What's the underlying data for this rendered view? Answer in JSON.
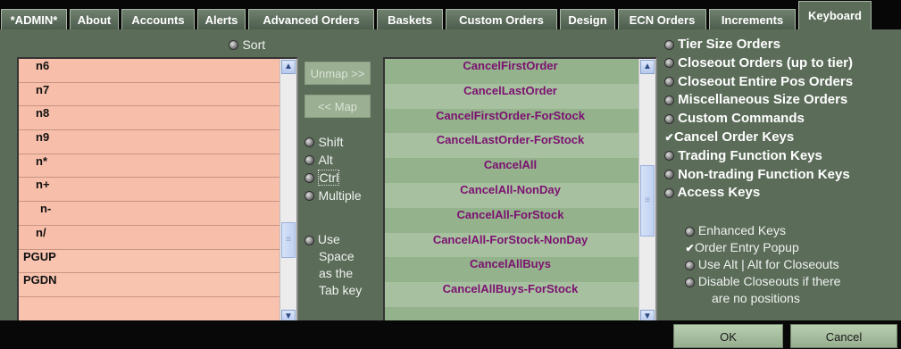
{
  "tabs": [
    "*ADMIN*",
    "About",
    "Accounts",
    "Alerts",
    "Advanced Orders",
    "Baskets",
    "Custom Orders",
    "Design",
    "ECN Orders",
    "Increments",
    "Keyboard"
  ],
  "sort_label": "Sort",
  "keys": [
    "n6",
    "n7",
    "n8",
    "n9",
    "n*",
    "n+",
    "n-",
    "n/",
    "PGUP",
    "PGDN"
  ],
  "unmap_label": "Unmap >>",
  "map_label": "<< Map",
  "modifiers": [
    "Shift",
    "Alt",
    "Ctrl",
    "Multiple"
  ],
  "use_space": [
    "Use",
    "Space",
    "as the",
    "Tab key"
  ],
  "commands": [
    "CancelFirstOrder",
    "CancelLastOrder",
    "CancelFirstOrder-ForStock",
    "CancelLastOrder-ForStock",
    "CancelAll",
    "CancelAll-NonDay",
    "CancelAll-ForStock",
    "CancelAll-ForStock-NonDay",
    "CancelAllBuys",
    "CancelAllBuys-ForStock"
  ],
  "categories": [
    "Tier Size Orders",
    "Closeout Orders (up to tier)",
    "Closeout Entire Pos Orders",
    "Miscellaneous Size Orders",
    "Custom Commands",
    "Cancel Order Keys",
    "Trading Function Keys",
    "Non-trading Function Keys",
    "Access Keys"
  ],
  "selected_category": "Cancel Order Keys",
  "options": [
    "Enhanced Keys",
    "Order Entry Popup",
    "Use Alt | Alt for Closeouts",
    "Disable Closeouts if there",
    "are no positions"
  ],
  "checked_option": "Order Entry Popup",
  "ok_label": "OK",
  "cancel_label": "Cancel",
  "colors": {
    "panel": "#5b6c59",
    "keys_bg": "#f8c2ae",
    "commands_bg": "#94b28c",
    "command_text": "#7c1170"
  }
}
